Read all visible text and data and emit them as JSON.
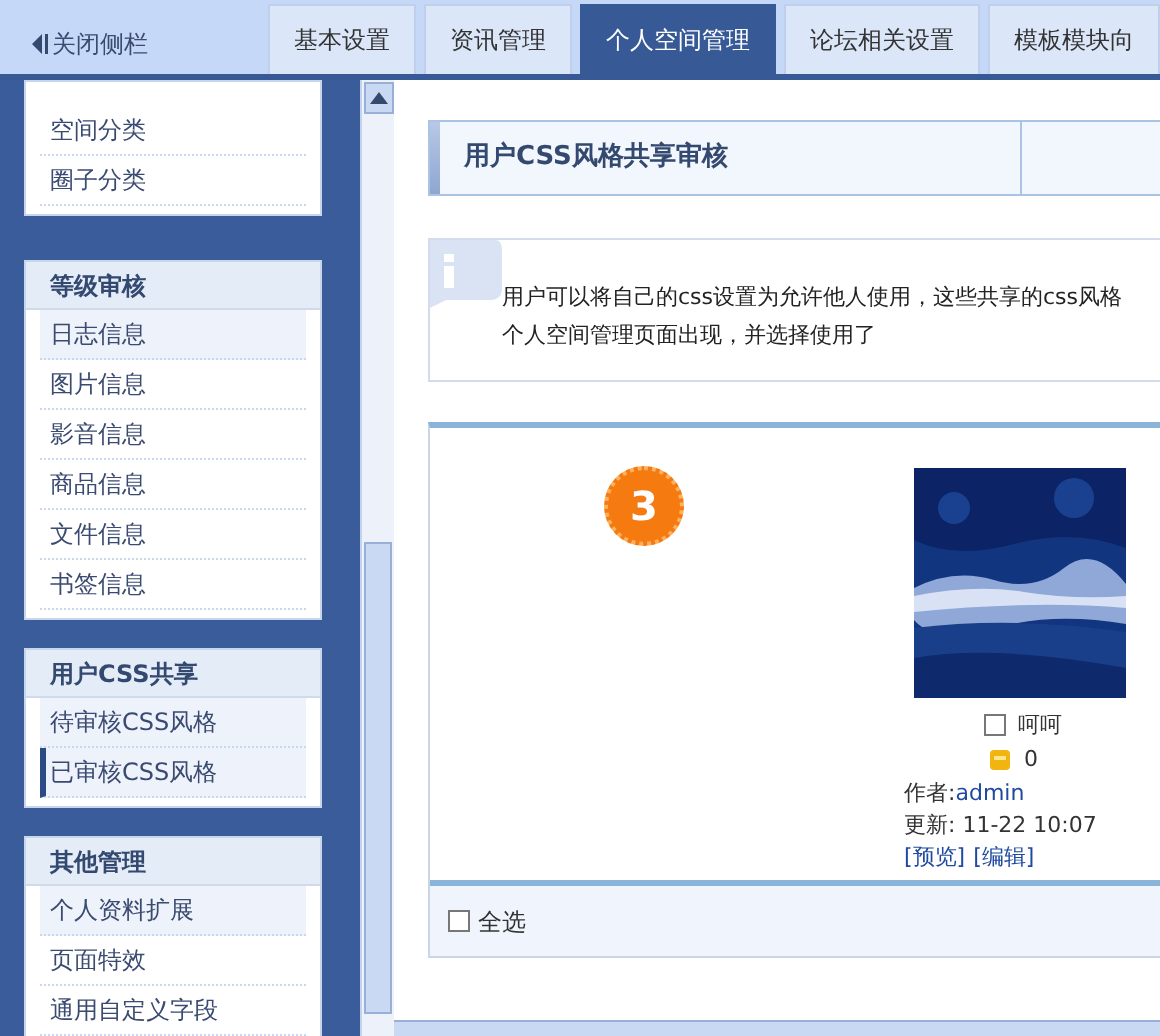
{
  "sidebar_toggle": {
    "label": "关闭侧栏"
  },
  "tabs": [
    {
      "label": "基本设置",
      "selected": false
    },
    {
      "label": "资讯管理",
      "selected": false
    },
    {
      "label": "个人空间管理",
      "selected": true
    },
    {
      "label": "论坛相关设置",
      "selected": false
    },
    {
      "label": "模板模块向",
      "selected": false
    }
  ],
  "sidebar": {
    "groups": [
      {
        "items": [
          {
            "label": "空间分类",
            "selected": false
          },
          {
            "label": "圈子分类",
            "selected": false
          }
        ]
      },
      {
        "title": "等级审核",
        "items": [
          {
            "label": "日志信息",
            "selected": false
          },
          {
            "label": "图片信息",
            "selected": false
          },
          {
            "label": "影音信息",
            "selected": false
          },
          {
            "label": "商品信息",
            "selected": false
          },
          {
            "label": "文件信息",
            "selected": false
          },
          {
            "label": "书签信息",
            "selected": false
          }
        ]
      },
      {
        "title": "用户CSS共享",
        "items": [
          {
            "label": "待审核CSS风格",
            "selected": false
          },
          {
            "label": "已审核CSS风格",
            "selected": true
          }
        ]
      },
      {
        "title": "其他管理",
        "items": [
          {
            "label": "个人资料扩展",
            "selected": false
          },
          {
            "label": "页面特效",
            "selected": false
          },
          {
            "label": "通用自定义字段",
            "selected": false
          }
        ]
      }
    ]
  },
  "page_title": "用户CSS风格共享审核",
  "info_lines": [
    "用户可以将自己的css设置为允许他人使用，这些共享的css风格",
    "个人空间管理页面出现，并选择使用了"
  ],
  "styles": [
    {
      "step_badge": "3",
      "kind": "picture",
      "name": "呵呵",
      "checked": false,
      "count": "0",
      "author_label": "作者:",
      "author": "admin",
      "updated": "更新: 11-22 10:07",
      "actions": [
        "[预览]",
        "[编辑]"
      ]
    }
  ],
  "select_all": {
    "label": "全选",
    "checked": false
  }
}
